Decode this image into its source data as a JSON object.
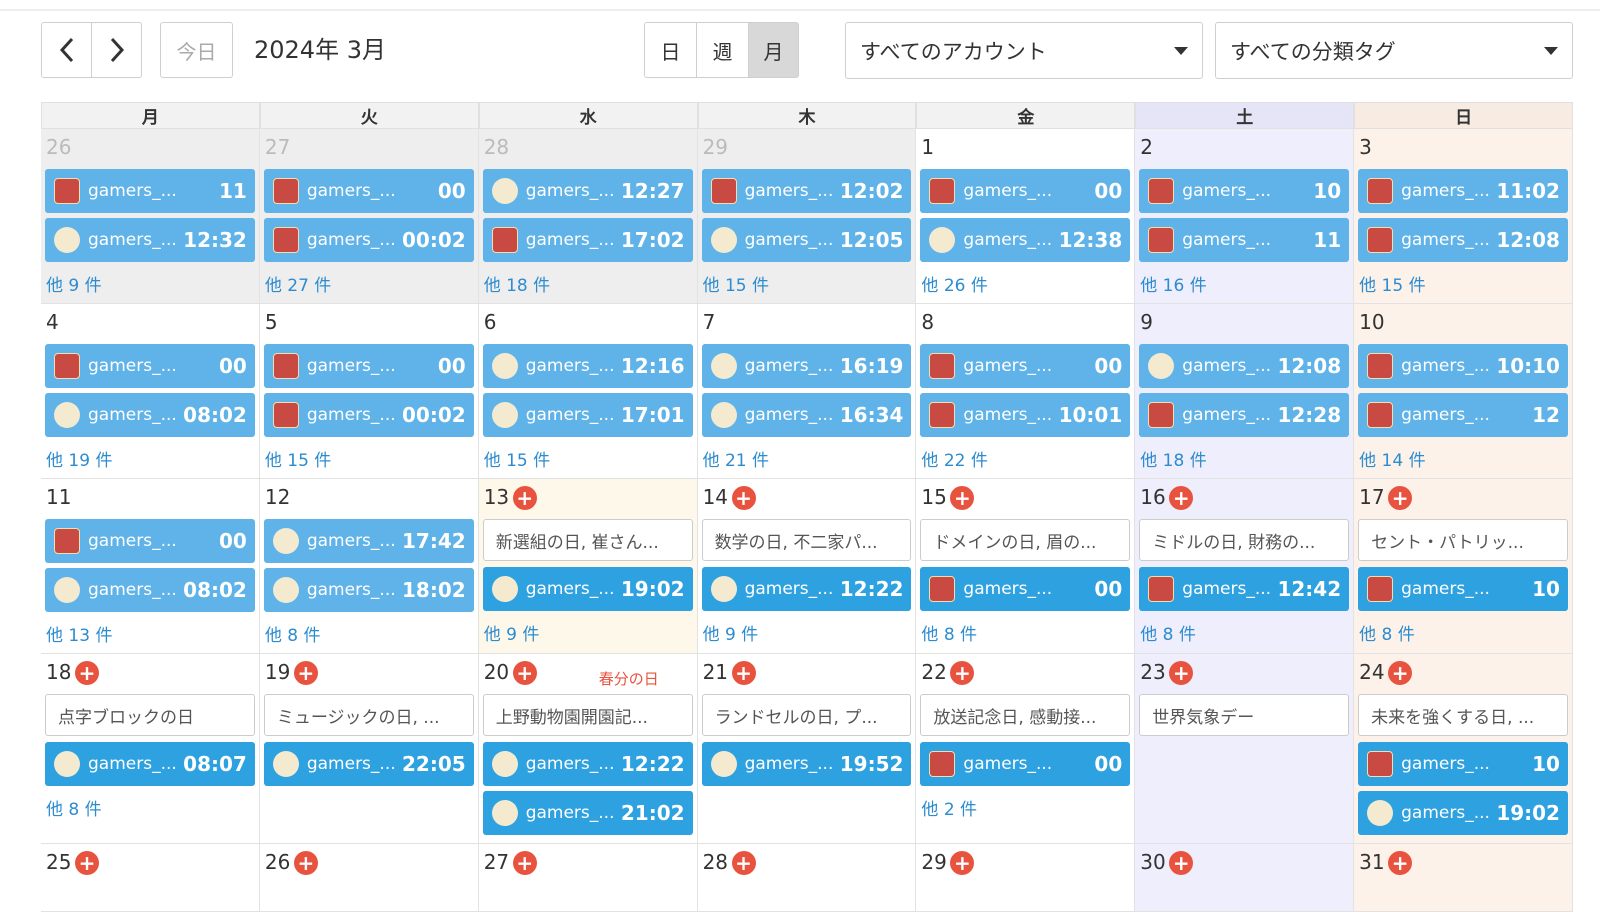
{
  "toolbar": {
    "prev_icon": "chevron-left-icon",
    "next_icon": "chevron-right-icon",
    "today_label": "今日",
    "month_title": "2024年 3月",
    "view_day": "日",
    "view_week": "週",
    "view_month": "月",
    "account_selected": "すべてのアカウント",
    "tag_selected": "すべての分類タグ"
  },
  "colors": {
    "event_bg": "#2ea1e0",
    "event_bg_light": "#5fb3e8",
    "more_link": "#2d8ccf",
    "add_badge": "#e8533f",
    "saturday_bg": "#efeefc",
    "sunday_bg": "#fcf2ea",
    "today_bg": "#fdf8ea",
    "other_month_bg": "#eeeeee"
  },
  "weekdays": [
    "月",
    "火",
    "水",
    "木",
    "金",
    "土",
    "日"
  ],
  "weeks": [
    [
      {
        "day": "26",
        "other": true,
        "events": [
          {
            "icon": "gift",
            "name": "gamers_...",
            "time": "11",
            "light": true
          },
          {
            "icon": "circle",
            "name": "gamers_...",
            "time": "12:32",
            "light": true
          }
        ],
        "more": "他 9 件"
      },
      {
        "day": "27",
        "other": true,
        "events": [
          {
            "icon": "gift",
            "name": "gamers_...",
            "time": "00",
            "light": true
          },
          {
            "icon": "gift",
            "name": "gamers_...",
            "time": "00:02",
            "light": true
          }
        ],
        "more": "他 27 件"
      },
      {
        "day": "28",
        "other": true,
        "events": [
          {
            "icon": "circle",
            "name": "gamers_...",
            "time": "12:27",
            "light": true
          },
          {
            "icon": "gift",
            "name": "gamers_...",
            "time": "17:02",
            "light": true
          }
        ],
        "more": "他 18 件"
      },
      {
        "day": "29",
        "other": true,
        "events": [
          {
            "icon": "gift",
            "name": "gamers_...",
            "time": "12:02",
            "light": true
          },
          {
            "icon": "circle",
            "name": "gamers_...",
            "time": "12:05",
            "light": true
          }
        ],
        "more": "他 15 件"
      },
      {
        "day": "1",
        "events": [
          {
            "icon": "gift",
            "name": "gamers_...",
            "time": "00",
            "light": true
          },
          {
            "icon": "circle",
            "name": "gamers_...",
            "time": "12:38",
            "light": true
          }
        ],
        "more": "他 26 件"
      },
      {
        "day": "2",
        "events": [
          {
            "icon": "gift",
            "name": "gamers_...",
            "time": "10",
            "light": true
          },
          {
            "icon": "gift",
            "name": "gamers_...",
            "time": "11",
            "light": true
          }
        ],
        "more": "他 16 件"
      },
      {
        "day": "3",
        "events": [
          {
            "icon": "gift",
            "name": "gamers_...",
            "time": "11:02",
            "light": true
          },
          {
            "icon": "gift",
            "name": "gamers_...",
            "time": "12:08",
            "light": true
          }
        ],
        "more": "他 15 件"
      }
    ],
    [
      {
        "day": "4",
        "events": [
          {
            "icon": "gift",
            "name": "gamers_...",
            "time": "00",
            "light": true
          },
          {
            "icon": "circle",
            "name": "gamers_...",
            "time": "08:02",
            "light": true
          }
        ],
        "more": "他 19 件"
      },
      {
        "day": "5",
        "events": [
          {
            "icon": "gift",
            "name": "gamers_...",
            "time": "00",
            "light": true
          },
          {
            "icon": "gift",
            "name": "gamers_...",
            "time": "00:02",
            "light": true
          }
        ],
        "more": "他 15 件"
      },
      {
        "day": "6",
        "events": [
          {
            "icon": "circle",
            "name": "gamers_...",
            "time": "12:16",
            "light": true
          },
          {
            "icon": "circle",
            "name": "gamers_...",
            "time": "17:01",
            "light": true
          }
        ],
        "more": "他 15 件"
      },
      {
        "day": "7",
        "events": [
          {
            "icon": "circle",
            "name": "gamers_...",
            "time": "16:19",
            "light": true
          },
          {
            "icon": "circle",
            "name": "gamers_...",
            "time": "16:34",
            "light": true
          }
        ],
        "more": "他 21 件"
      },
      {
        "day": "8",
        "events": [
          {
            "icon": "gift",
            "name": "gamers_...",
            "time": "00",
            "light": true
          },
          {
            "icon": "gift",
            "name": "gamers_...",
            "time": "10:01",
            "light": true
          }
        ],
        "more": "他 22 件"
      },
      {
        "day": "9",
        "events": [
          {
            "icon": "circle",
            "name": "gamers_...",
            "time": "12:08",
            "light": true
          },
          {
            "icon": "gift",
            "name": "gamers_...",
            "time": "12:28",
            "light": true
          }
        ],
        "more": "他 18 件"
      },
      {
        "day": "10",
        "events": [
          {
            "icon": "gift",
            "name": "gamers_...",
            "time": "10:10",
            "light": true
          },
          {
            "icon": "gift",
            "name": "gamers_...",
            "time": "12",
            "light": true
          }
        ],
        "more": "他 14 件"
      }
    ],
    [
      {
        "day": "11",
        "events": [
          {
            "icon": "gift",
            "name": "gamers_...",
            "time": "00",
            "light": true
          },
          {
            "icon": "circle",
            "name": "gamers_...",
            "time": "08:02",
            "light": true
          }
        ],
        "more": "他 13 件"
      },
      {
        "day": "12",
        "events": [
          {
            "icon": "circle",
            "name": "gamers_...",
            "time": "17:42",
            "light": true
          },
          {
            "icon": "circle",
            "name": "gamers_...",
            "time": "18:02",
            "light": true
          }
        ],
        "more": "他 8 件"
      },
      {
        "day": "13",
        "plus": true,
        "today": true,
        "note": "新選組の日, 崔さん...",
        "events": [
          {
            "icon": "circle",
            "name": "gamers_...",
            "time": "19:02"
          }
        ],
        "more": "他 9 件"
      },
      {
        "day": "14",
        "plus": true,
        "note": "数学の日, 不二家パ...",
        "events": [
          {
            "icon": "circle",
            "name": "gamers_...",
            "time": "12:22"
          }
        ],
        "more": "他 9 件"
      },
      {
        "day": "15",
        "plus": true,
        "note": "ドメインの日, 眉の...",
        "events": [
          {
            "icon": "gift",
            "name": "gamers_...",
            "time": "00"
          }
        ],
        "more": "他 8 件"
      },
      {
        "day": "16",
        "plus": true,
        "note": "ミドルの日, 財務の...",
        "events": [
          {
            "icon": "gift",
            "name": "gamers_...",
            "time": "12:42"
          }
        ],
        "more": "他 8 件"
      },
      {
        "day": "17",
        "plus": true,
        "note": "セント・パトリッ...",
        "events": [
          {
            "icon": "gift",
            "name": "gamers_...",
            "time": "10"
          }
        ],
        "more": "他 8 件"
      }
    ],
    [
      {
        "day": "18",
        "plus": true,
        "note": "点字ブロックの日",
        "events": [
          {
            "icon": "circle",
            "name": "gamers_...",
            "time": "08:07"
          }
        ],
        "more": "他 8 件"
      },
      {
        "day": "19",
        "plus": true,
        "note": "ミュージックの日, ...",
        "events": [
          {
            "icon": "circle",
            "name": "gamers_...",
            "time": "22:05"
          }
        ],
        "more": ""
      },
      {
        "day": "20",
        "plus": true,
        "holiday": "春分の日",
        "note": "上野動物園開園記...",
        "events": [
          {
            "icon": "circle",
            "name": "gamers_...",
            "time": "12:22"
          },
          {
            "icon": "circle",
            "name": "gamers_...",
            "time": "21:02"
          }
        ],
        "more": ""
      },
      {
        "day": "21",
        "plus": true,
        "note": "ランドセルの日, プ...",
        "events": [
          {
            "icon": "circle",
            "name": "gamers_...",
            "time": "19:52"
          }
        ],
        "more": ""
      },
      {
        "day": "22",
        "plus": true,
        "note": "放送記念日, 感動接...",
        "events": [
          {
            "icon": "gift",
            "name": "gamers_...",
            "time": "00"
          }
        ],
        "more": "他 2 件"
      },
      {
        "day": "23",
        "plus": true,
        "note": "世界気象デー",
        "events": [],
        "more": ""
      },
      {
        "day": "24",
        "plus": true,
        "note": "未来を強くする日, ...",
        "events": [
          {
            "icon": "gift",
            "name": "gamers_...",
            "time": "10"
          },
          {
            "icon": "circle",
            "name": "gamers_...",
            "time": "19:02"
          }
        ],
        "more": ""
      }
    ],
    [
      {
        "day": "25",
        "plus": true,
        "events": [],
        "more": ""
      },
      {
        "day": "26",
        "plus": true,
        "events": [],
        "more": ""
      },
      {
        "day": "27",
        "plus": true,
        "events": [],
        "more": ""
      },
      {
        "day": "28",
        "plus": true,
        "events": [],
        "more": ""
      },
      {
        "day": "29",
        "plus": true,
        "events": [],
        "more": ""
      },
      {
        "day": "30",
        "plus": true,
        "events": [],
        "more": ""
      },
      {
        "day": "31",
        "plus": true,
        "events": [],
        "more": ""
      }
    ]
  ]
}
